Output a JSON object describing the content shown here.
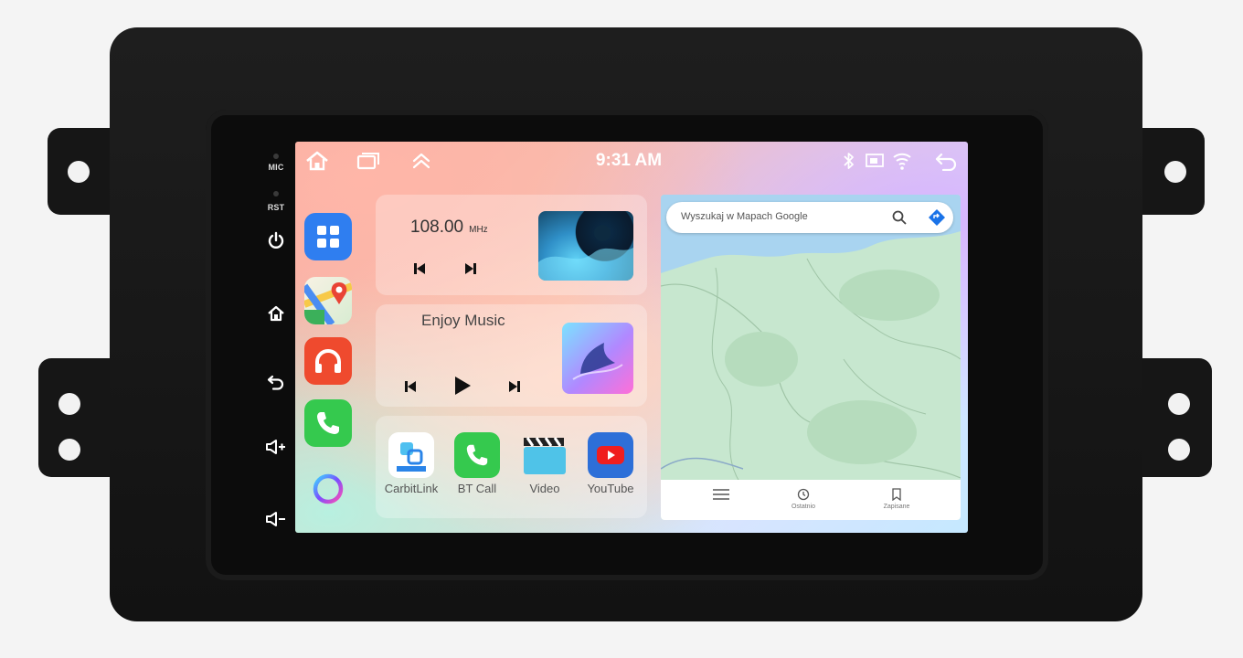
{
  "side_panel": {
    "mic_label": "MIC",
    "rst_label": "RST",
    "buttons": [
      "power-icon",
      "home-icon",
      "back-icon",
      "volume-up-icon",
      "volume-down-icon"
    ]
  },
  "status_bar": {
    "time": "9:31 AM",
    "left_icons": [
      "home-icon",
      "recent-apps-icon",
      "chevron-up-icon"
    ],
    "right_icons": [
      "bluetooth-icon",
      "screen-mirror-icon",
      "wifi-icon",
      "back-icon"
    ]
  },
  "dock": {
    "apps": [
      "app-drawer-icon",
      "maps-icon",
      "music-icon",
      "phone-icon",
      "assistant-icon"
    ]
  },
  "radio": {
    "frequency": "108.00",
    "unit": "MHz"
  },
  "music": {
    "title": "Enjoy Music"
  },
  "apps": [
    {
      "label": "CarbitLink",
      "icon": "carbitlink-icon"
    },
    {
      "label": "BT Call",
      "icon": "phone-icon"
    },
    {
      "label": "Video",
      "icon": "clapper-icon"
    },
    {
      "label": "YouTube",
      "icon": "youtube-icon"
    }
  ],
  "map": {
    "search_placeholder": "Wyszukaj w Mapach Google",
    "bottom_tabs": [
      "",
      "Ostatnio",
      "Zapisane"
    ]
  },
  "colors": {
    "dock_blue": "#2f7ef0",
    "dock_red": "#ef4a2e",
    "dock_green": "#35c94e",
    "youtube_red": "#f01e1e"
  }
}
